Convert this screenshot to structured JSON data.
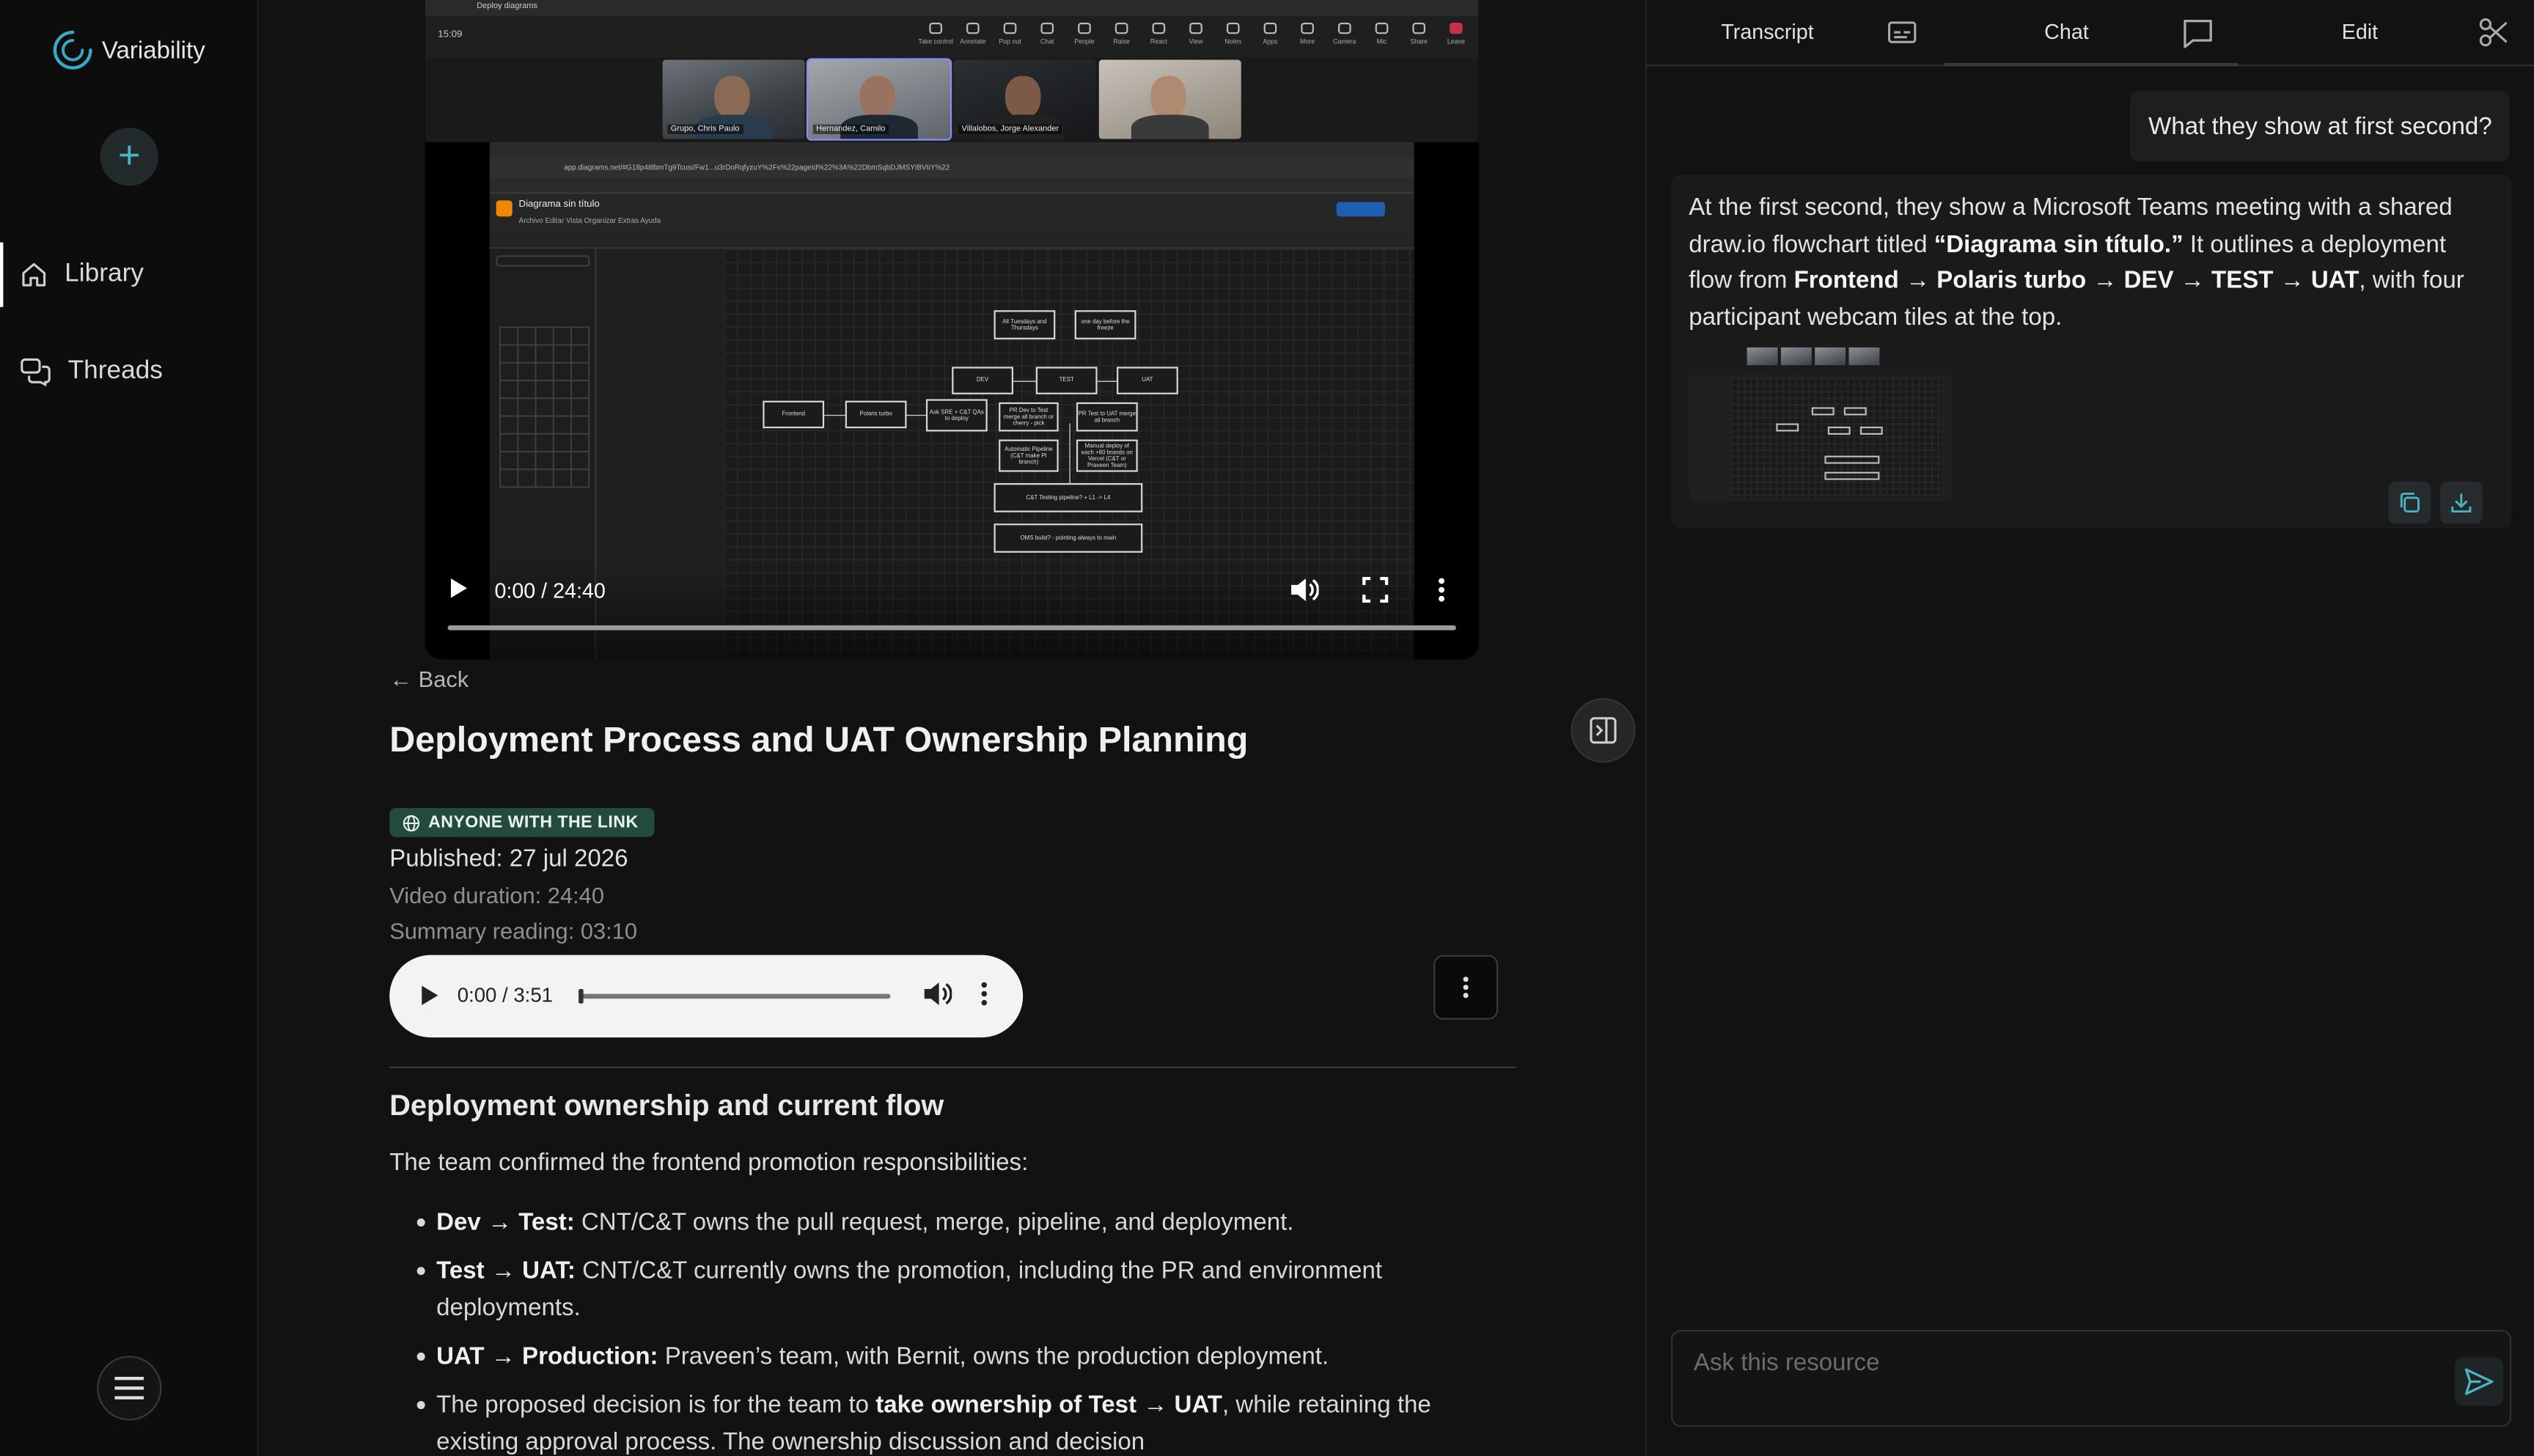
{
  "sidebar": {
    "brand": "Variability",
    "items": [
      {
        "label": "Library"
      },
      {
        "label": "Threads"
      }
    ]
  },
  "video": {
    "window_title": "Deploy diagrams",
    "meeting_time": "15:09",
    "teams_toolbar": [
      "Take control",
      "Annotate",
      "Pop out",
      "Chat",
      "People",
      "Raise",
      "React",
      "View",
      "Notes",
      "Apps",
      "More",
      "Camera",
      "Mic",
      "Share",
      "Leave"
    ],
    "participants": [
      "Grupo, Chris Paulo",
      "Hernandez, Camilo",
      "Villalobos, Jorge Alexander",
      ""
    ],
    "browser_url": "app.diagrams.net/#G18p48lbmTg9Tcusi/Fw1...u3rDoRqfyzuY%2Fs%22pageId%22%3A%22DbmSqbDJMSYIBVtiY%22",
    "diagram_title": "Diagrama sin título",
    "diagram_menu": "Archivo  Editar  Vista  Organizar  Extras  Ayuda",
    "flow_boxes": [
      "Frontend",
      "Polaris turbo",
      "Ask SRE + C&T QAs to deploy",
      "DEV",
      "TEST",
      "UAT",
      "All Tuesdays and Thursdays",
      "one day before the freeze",
      "PR Dev to Test merge all branch or cherry - pick",
      "PR Test to UAT merge all branch",
      "Automatic Pipeline (C&T make PI branch)",
      "Manual deploy of each +80 brands on Vercel (C&T or Praveen Team)",
      "C&T Testing pipeline? + L1 -> L4",
      "OMS build? - pointing always to main"
    ],
    "time": "0:00 / 24:40",
    "progress_fraction": 0.0
  },
  "main": {
    "back_label": "← Back",
    "title": "Deployment Process and UAT Ownership Planning",
    "visibility_badge": "ANYONE WITH THE LINK",
    "published": "Published: 27 jul 2026",
    "video_duration": "Video duration: 24:40",
    "summary_reading": "Summary reading: 03:10",
    "audio_time": "0:00 / 3:51",
    "section_title": "Deployment ownership and current flow",
    "section_intro": "The team confirmed the frontend promotion responsibilities:",
    "bullets": [
      {
        "bold": "Dev → Test:",
        "text": " CNT/C&T owns the pull request, merge, pipeline, and deployment."
      },
      {
        "bold": "Test → UAT:",
        "text": " CNT/C&T currently owns the promotion, including the PR and environment deployments."
      },
      {
        "bold": "UAT → Production:",
        "text": " Praveen’s team, with Bernit, owns the production deployment."
      },
      {
        "pre": "The proposed decision is for the team to ",
        "bold": "take ownership of Test → UAT",
        "text": ", while retaining the existing approval process. The ownership discussion and decision"
      }
    ]
  },
  "panel": {
    "tabs": [
      {
        "label": "Transcript",
        "icon": "subtitles-icon"
      },
      {
        "label": "Chat",
        "icon": "chat-bubble-icon"
      },
      {
        "label": "Edit",
        "icon": "scissors-icon"
      }
    ],
    "user_message": "What they show at first second?",
    "ai_message": {
      "p1": "At the first second, they show a Microsoft Teams meeting with a shared draw.io flowchart titled ",
      "b1": "“Diagrama sin título.”",
      "p2": " It outlines a deployment flow from ",
      "b2": "Frontend → Polaris turbo → DEV → TEST → UAT",
      "p3": ", with four participant webcam tiles at the top."
    },
    "ask_placeholder": "Ask this resource"
  },
  "colors": {
    "accent": "#4db2c2",
    "badge_bg": "#234a3b",
    "leave": "#c4314b"
  }
}
